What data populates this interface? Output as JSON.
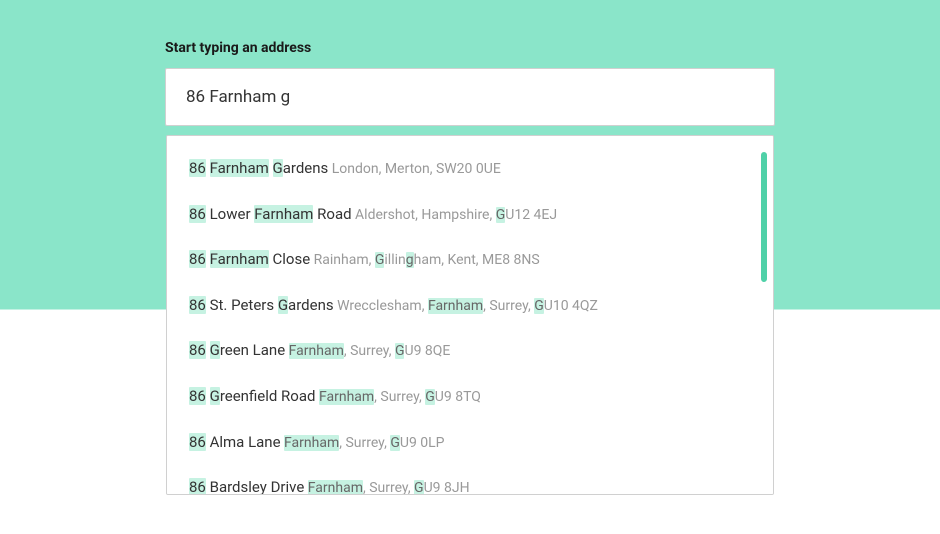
{
  "label": "Start typing an address",
  "input_value": "86 Farnham g",
  "colors": {
    "highlight_bg": "#c6f2e2",
    "accent": "#4fd1a8",
    "bg_top": "#8ae5c9"
  },
  "suggestions": [
    {
      "primary_segments": [
        {
          "t": "86",
          "hl": true
        },
        {
          "t": " "
        },
        {
          "t": "Farnham",
          "hl": true
        },
        {
          "t": " "
        },
        {
          "t": "G",
          "hl": true
        },
        {
          "t": "ardens"
        }
      ],
      "secondary_segments": [
        {
          "t": " London, Merton, SW20 0UE"
        }
      ]
    },
    {
      "primary_segments": [
        {
          "t": "86",
          "hl": true
        },
        {
          "t": " Lower "
        },
        {
          "t": "Farnham",
          "hl": true
        },
        {
          "t": " Road"
        }
      ],
      "secondary_segments": [
        {
          "t": " Aldershot, Hampshire, "
        },
        {
          "t": "G",
          "hl": true
        },
        {
          "t": "U12 4EJ"
        }
      ]
    },
    {
      "primary_segments": [
        {
          "t": "86",
          "hl": true
        },
        {
          "t": " "
        },
        {
          "t": "Farnham",
          "hl": true
        },
        {
          "t": " Close"
        }
      ],
      "secondary_segments": [
        {
          "t": " Rainham, "
        },
        {
          "t": "G",
          "hl": true
        },
        {
          "t": "illin"
        },
        {
          "t": "g",
          "hl": true
        },
        {
          "t": "ham, Kent, ME8 8NS"
        }
      ]
    },
    {
      "primary_segments": [
        {
          "t": "86",
          "hl": true
        },
        {
          "t": " St. Peters "
        },
        {
          "t": "G",
          "hl": true
        },
        {
          "t": "ardens"
        }
      ],
      "secondary_segments": [
        {
          "t": " Wrecclesham, "
        },
        {
          "t": "Farnham",
          "hl": true
        },
        {
          "t": ", Surrey, "
        },
        {
          "t": "G",
          "hl": true
        },
        {
          "t": "U10 4QZ"
        }
      ]
    },
    {
      "primary_segments": [
        {
          "t": "86",
          "hl": true
        },
        {
          "t": " "
        },
        {
          "t": "G",
          "hl": true
        },
        {
          "t": "reen Lane"
        }
      ],
      "secondary_segments": [
        {
          "t": " "
        },
        {
          "t": "Farnham",
          "hl": true
        },
        {
          "t": ", Surrey, "
        },
        {
          "t": "G",
          "hl": true
        },
        {
          "t": "U9 8QE"
        }
      ]
    },
    {
      "primary_segments": [
        {
          "t": "86",
          "hl": true
        },
        {
          "t": " "
        },
        {
          "t": "G",
          "hl": true
        },
        {
          "t": "reenfield Road"
        }
      ],
      "secondary_segments": [
        {
          "t": " "
        },
        {
          "t": "Farnham",
          "hl": true
        },
        {
          "t": ", Surrey, "
        },
        {
          "t": "G",
          "hl": true
        },
        {
          "t": "U9 8TQ"
        }
      ]
    },
    {
      "primary_segments": [
        {
          "t": "86",
          "hl": true
        },
        {
          "t": " Alma Lane"
        }
      ],
      "secondary_segments": [
        {
          "t": " "
        },
        {
          "t": "Farnham",
          "hl": true
        },
        {
          "t": ", Surrey, "
        },
        {
          "t": "G",
          "hl": true
        },
        {
          "t": "U9 0LP"
        }
      ]
    },
    {
      "primary_segments": [
        {
          "t": "86",
          "hl": true
        },
        {
          "t": " Bardsley Drive"
        }
      ],
      "secondary_segments": [
        {
          "t": " "
        },
        {
          "t": "Farnham",
          "hl": true
        },
        {
          "t": ", Surrey, "
        },
        {
          "t": "G",
          "hl": true
        },
        {
          "t": "U9 8JH"
        }
      ]
    }
  ]
}
